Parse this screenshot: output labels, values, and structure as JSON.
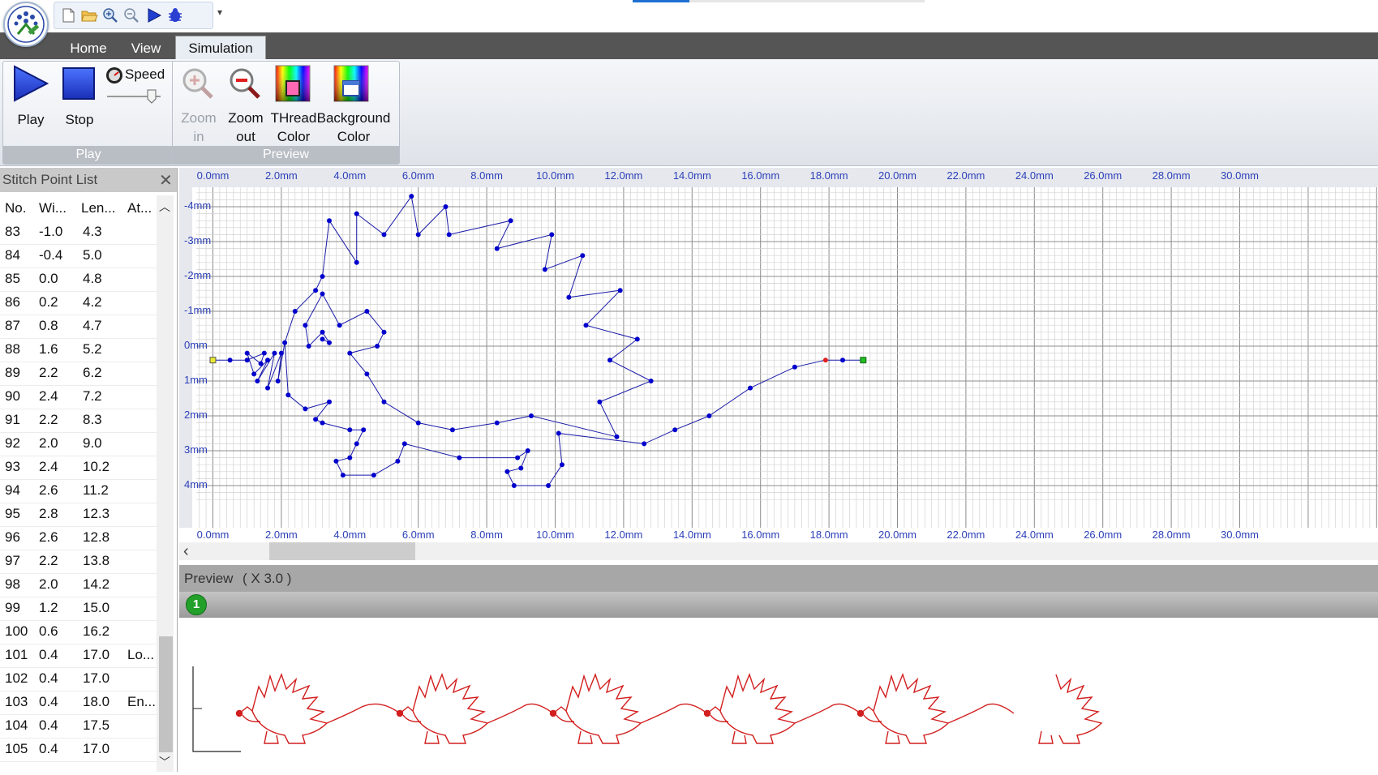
{
  "quick_access": {
    "icons": [
      "new-file-icon",
      "open-folder-icon",
      "zoom-in-icon",
      "zoom-out-icon",
      "play-icon",
      "bug-icon"
    ],
    "more": "▾"
  },
  "tabs": [
    "Home",
    "View",
    "Simulation"
  ],
  "active_tab": "Simulation",
  "ribbon": {
    "play_group": {
      "label": "Play",
      "play": "Play",
      "stop": "Stop",
      "speed": "Speed"
    },
    "preview_group": {
      "label": "Preview",
      "zoom_in": [
        "Zoom",
        "in"
      ],
      "zoom_out": [
        "Zoom",
        "out"
      ],
      "thread_color": [
        "THread",
        "Color"
      ],
      "background_color": [
        "Background",
        "Color"
      ]
    }
  },
  "stitch_panel": {
    "title": "Stitch Point List",
    "close": "✕",
    "columns": [
      "No.",
      "Wi...",
      "Len...",
      "At..."
    ],
    "rows": [
      [
        "83",
        "-1.0",
        "4.3",
        ""
      ],
      [
        "84",
        "-0.4",
        "5.0",
        ""
      ],
      [
        "85",
        "0.0",
        "4.8",
        ""
      ],
      [
        "86",
        "0.2",
        "4.2",
        ""
      ],
      [
        "87",
        "0.8",
        "4.7",
        ""
      ],
      [
        "88",
        "1.6",
        "5.2",
        ""
      ],
      [
        "89",
        "2.2",
        "6.2",
        ""
      ],
      [
        "90",
        "2.4",
        "7.2",
        ""
      ],
      [
        "91",
        "2.2",
        "8.3",
        ""
      ],
      [
        "92",
        "2.0",
        "9.0",
        ""
      ],
      [
        "93",
        "2.4",
        "10.2",
        ""
      ],
      [
        "94",
        "2.6",
        "11.2",
        ""
      ],
      [
        "95",
        "2.8",
        "12.3",
        ""
      ],
      [
        "96",
        "2.6",
        "12.8",
        ""
      ],
      [
        "97",
        "2.2",
        "13.8",
        ""
      ],
      [
        "98",
        "2.0",
        "14.2",
        ""
      ],
      [
        "99",
        "1.2",
        "15.0",
        ""
      ],
      [
        "100",
        "0.6",
        "16.2",
        ""
      ],
      [
        "101",
        "0.4",
        "17.0",
        "Lo..."
      ],
      [
        "102",
        "0.4",
        "17.0",
        ""
      ],
      [
        "103",
        "0.4",
        "18.0",
        "En..."
      ],
      [
        "104",
        "0.4",
        "17.5",
        ""
      ],
      [
        "105",
        "0.4",
        "17.0",
        ""
      ]
    ]
  },
  "ruler": {
    "x_labels": [
      "0.0mm",
      "2.0mm",
      "4.0mm",
      "6.0mm",
      "8.0mm",
      "10.0mm",
      "12.0mm",
      "14.0mm",
      "16.0mm",
      "18.0mm",
      "20.0mm",
      "22.0mm",
      "24.0mm",
      "26.0mm",
      "28.0mm",
      "30.0mm"
    ],
    "y_labels": [
      "-4mm",
      "-3mm",
      "-2mm",
      "-1mm",
      "0mm",
      "1mm",
      "2mm",
      "3mm",
      "4mm"
    ]
  },
  "preview": {
    "label": "Preview",
    "zoom": "( X 3.0 )",
    "badge": "1"
  },
  "colors": {
    "stitch_line": "#1a1aa8",
    "stitch_point": "#0000cc",
    "preview_thread": "#d21e1e",
    "start_marker": "#e8e830",
    "end_marker": "#22bb22",
    "current_marker": "#e02020"
  },
  "stitch_points_mm": [
    [
      0.0,
      0.4
    ],
    [
      0.5,
      0.4
    ],
    [
      1.0,
      0.4
    ],
    [
      1.5,
      0.2
    ],
    [
      1.4,
      0.5
    ],
    [
      1.0,
      0.2
    ],
    [
      1.2,
      0.8
    ],
    [
      1.6,
      0.4
    ],
    [
      1.3,
      1.0
    ],
    [
      1.8,
      0.2
    ],
    [
      1.6,
      1.2
    ],
    [
      2.0,
      0.2
    ],
    [
      1.9,
      1.0
    ],
    [
      2.1,
      -0.1
    ],
    [
      2.2,
      1.4
    ],
    [
      2.7,
      1.8
    ],
    [
      3.4,
      1.6
    ],
    [
      3.0,
      2.1
    ],
    [
      3.2,
      2.2
    ],
    [
      4.0,
      2.4
    ],
    [
      4.4,
      2.4
    ],
    [
      4.2,
      2.8
    ],
    [
      4.0,
      3.2
    ],
    [
      3.6,
      3.3
    ],
    [
      3.8,
      3.7
    ],
    [
      4.7,
      3.7
    ],
    [
      5.4,
      3.3
    ],
    [
      5.6,
      2.8
    ],
    [
      7.2,
      3.2
    ],
    [
      8.9,
      3.2
    ],
    [
      9.2,
      3.0
    ],
    [
      9.0,
      3.5
    ],
    [
      8.6,
      3.6
    ],
    [
      8.8,
      4.0
    ],
    [
      9.8,
      4.0
    ],
    [
      10.2,
      3.4
    ],
    [
      10.1,
      2.5
    ],
    [
      12.6,
      2.8
    ],
    [
      13.5,
      2.4
    ],
    [
      14.5,
      2.0
    ],
    [
      15.7,
      1.2
    ],
    [
      17.0,
      0.6
    ],
    [
      17.9,
      0.4
    ],
    [
      18.4,
      0.4
    ],
    [
      19.0,
      0.4
    ],
    [
      2.4,
      -1.0
    ],
    [
      3.0,
      -1.6
    ],
    [
      3.2,
      -2.0
    ],
    [
      3.4,
      -3.6
    ],
    [
      4.2,
      -2.4
    ],
    [
      4.2,
      -3.8
    ],
    [
      5.0,
      -3.2
    ],
    [
      5.8,
      -4.3
    ],
    [
      6.0,
      -3.2
    ],
    [
      6.8,
      -4.0
    ],
    [
      6.9,
      -3.2
    ],
    [
      8.7,
      -3.6
    ],
    [
      8.3,
      -2.8
    ],
    [
      9.9,
      -3.2
    ],
    [
      9.7,
      -2.2
    ],
    [
      10.8,
      -2.6
    ],
    [
      10.4,
      -1.4
    ],
    [
      11.9,
      -1.6
    ],
    [
      10.9,
      -0.6
    ],
    [
      12.4,
      -0.2
    ],
    [
      11.6,
      0.4
    ],
    [
      12.8,
      1.0
    ],
    [
      11.3,
      1.6
    ],
    [
      11.8,
      2.6
    ],
    [
      9.3,
      2.0
    ],
    [
      8.3,
      2.2
    ],
    [
      7.0,
      2.4
    ],
    [
      6.0,
      2.2
    ],
    [
      5.0,
      1.6
    ],
    [
      4.5,
      0.8
    ],
    [
      4.0,
      0.2
    ],
    [
      4.8,
      0.0
    ],
    [
      5.0,
      -0.4
    ],
    [
      4.5,
      -1.0
    ],
    [
      3.7,
      -0.6
    ],
    [
      3.2,
      -1.5
    ],
    [
      2.7,
      -0.6
    ],
    [
      2.8,
      0.0
    ],
    [
      3.2,
      -0.4
    ],
    [
      3.4,
      -0.1
    ],
    [
      3.2,
      -0.2
    ]
  ]
}
